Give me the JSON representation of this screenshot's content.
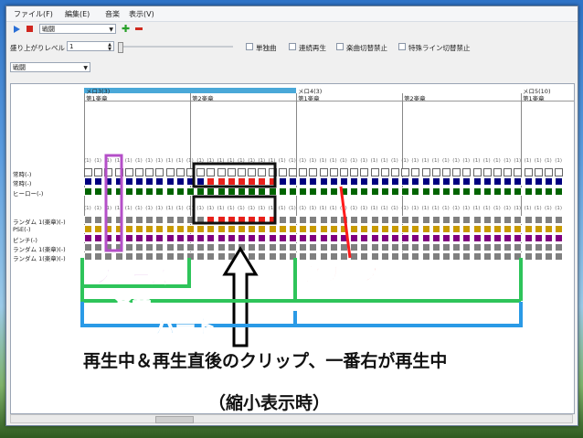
{
  "menu": [
    "ファイル(F)",
    "編集(E)",
    "音楽",
    "表示(V)"
  ],
  "toolbar": {
    "play_icon": "play-triangle-icon",
    "stop_icon": "stop-square-icon",
    "song_select": "戦闘",
    "add_icon": "green-plus-icon",
    "remove_icon": "red-minus-icon"
  },
  "controls": {
    "level_label": "盛り上がりレベル",
    "level_value": "1",
    "checkboxes": [
      "単独曲",
      "連続再生",
      "楽曲切替禁止",
      "特殊ライン切替禁止"
    ]
  },
  "theme_select": "戦闘",
  "sections": [
    {
      "name": "メロ3(3)",
      "bars": [
        "第1楽章",
        "第2楽章"
      ]
    },
    {
      "name": "メロ4(3)",
      "bars": [
        "第1楽章",
        "第2楽章"
      ]
    },
    {
      "name": "メロ5(10)",
      "bars": [
        "第1楽章"
      ]
    }
  ],
  "clip_count_label": "(1)",
  "tracks_group1": [
    "常時(-)",
    "常時(-)",
    "ヒーロー(-)"
  ],
  "tracks_group2": [
    "ランダム 1(楽章)(-)",
    "PSE(-)",
    "ピンチ(-)",
    "ランダム 1(楽章)(-)",
    "ランダム 1(楽章)(-)"
  ],
  "colors": {
    "accent": "#4aa8d8",
    "navy": "#000080",
    "green": "#006400",
    "gray": "#808080",
    "gold": "#c89a00",
    "purple": "#800080",
    "playing": "#e8201a",
    "ann_green": "#2ec45a",
    "ann_purple": "#b44fc8",
    "ann_red": "#ff1a1a",
    "ann_blue": "#2a9ae6"
  },
  "annotations": {
    "phrase": "フレーズ",
    "movement": "楽章",
    "part": "パート",
    "clip": "クリップ",
    "caption": "再生中＆再生直後のクリップ、一番右が再生中",
    "subcaption": "（縮小表示時）"
  }
}
